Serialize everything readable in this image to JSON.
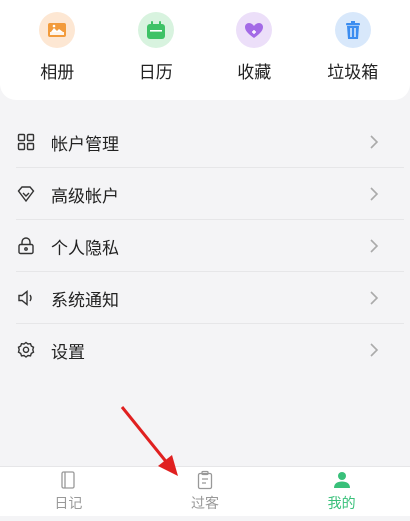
{
  "quick_access": [
    {
      "label": "相册",
      "icon": "photo-album-icon",
      "color": "#f29b3c",
      "bg": "#fde7d3"
    },
    {
      "label": "日历",
      "icon": "calendar-icon",
      "color": "#3ec266",
      "bg": "#d8f3df"
    },
    {
      "label": "收藏",
      "icon": "favorite-heart-icon",
      "color": "#a36ae6",
      "bg": "#ecdff9"
    },
    {
      "label": "垃圾箱",
      "icon": "trash-bin-icon",
      "color": "#3c8df0",
      "bg": "#d8e8fb"
    }
  ],
  "menu": [
    {
      "label": "帐户管理",
      "icon": "grid-icon"
    },
    {
      "label": "高级帐户",
      "icon": "diamond-icon"
    },
    {
      "label": "个人隐私",
      "icon": "lock-icon"
    },
    {
      "label": "系统通知",
      "icon": "speaker-icon"
    },
    {
      "label": "设置",
      "icon": "gear-icon"
    }
  ],
  "tabs": [
    {
      "label": "日记",
      "icon": "diary-book-icon",
      "active": false
    },
    {
      "label": "过客",
      "icon": "clipboard-icon",
      "active": false
    },
    {
      "label": "我的",
      "icon": "user-profile-icon",
      "active": true
    }
  ],
  "colors": {
    "accent": "#39c07a",
    "arrow": "#e02020"
  }
}
